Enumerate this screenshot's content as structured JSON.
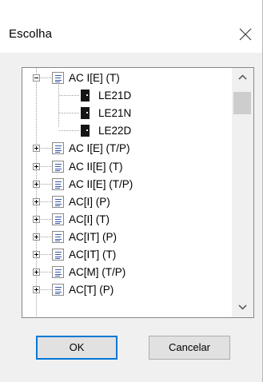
{
  "dialog": {
    "title": "Escolha",
    "close_icon": "close-icon"
  },
  "tree": {
    "items": [
      {
        "label": "AC I[E] (T)",
        "type": "group",
        "expanded": true,
        "icon": "list-group-icon"
      },
      {
        "label": "LE21D",
        "type": "leaf",
        "icon": "device-icon"
      },
      {
        "label": "LE21N",
        "type": "leaf",
        "icon": "device-icon"
      },
      {
        "label": "LE22D",
        "type": "leaf",
        "icon": "device-icon"
      },
      {
        "label": "AC I[E] (T/P)",
        "type": "group",
        "expanded": false,
        "icon": "list-group-icon"
      },
      {
        "label": "AC II[E] (T)",
        "type": "group",
        "expanded": false,
        "icon": "list-group-icon"
      },
      {
        "label": "AC II[E] (T/P)",
        "type": "group",
        "expanded": false,
        "icon": "list-group-icon"
      },
      {
        "label": "AC[I] (P)",
        "type": "group",
        "expanded": false,
        "icon": "list-group-icon"
      },
      {
        "label": "AC[I] (T)",
        "type": "group",
        "expanded": false,
        "icon": "list-group-icon"
      },
      {
        "label": "AC[IT] (P)",
        "type": "group",
        "expanded": false,
        "icon": "list-group-icon"
      },
      {
        "label": "AC[IT] (T)",
        "type": "group",
        "expanded": false,
        "icon": "list-group-icon"
      },
      {
        "label": "AC[M] (T/P)",
        "type": "group",
        "expanded": false,
        "icon": "list-group-icon"
      },
      {
        "label": "AC[T] (P)",
        "type": "group",
        "expanded": false,
        "icon": "list-group-icon"
      }
    ]
  },
  "buttons": {
    "ok_label": "OK",
    "cancel_label": "Cancelar"
  },
  "colors": {
    "focus_border": "#0078d7",
    "button_face": "#e1e1e1",
    "dialog_face": "#f0f0f0"
  }
}
